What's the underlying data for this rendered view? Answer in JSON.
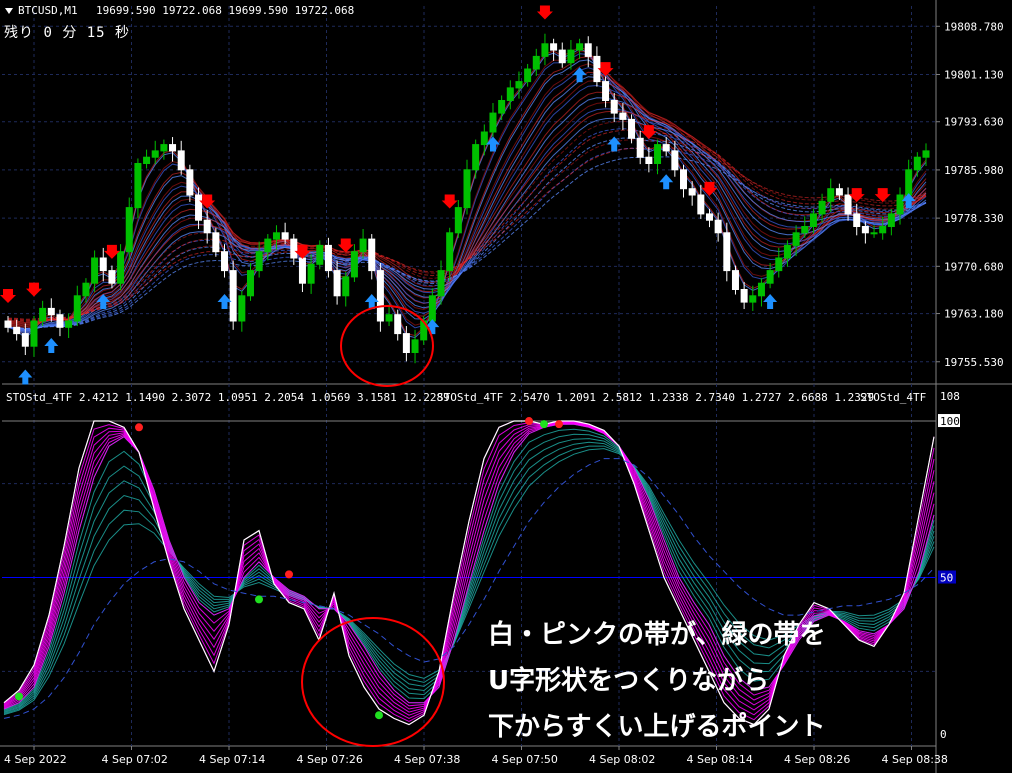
{
  "header": {
    "symbol": "BTCUSD,M1",
    "ohlc": "19699.590 19722.068 19699.590 19722.068",
    "timer_label": "残り",
    "timer_min": "0",
    "timer_min_unit": "分",
    "timer_sec": "15",
    "timer_sec_unit": "秒"
  },
  "indicator_header": {
    "label1": "STOStd_4TF 2.4212 1.1490 2.3072 1.0951 2.2054 1.0569 3.1581 12.2289",
    "label2": "STOStd_4TF 2.5470 1.2091 2.5812 1.2338 2.7340 1.2727 2.6688 1.2329",
    "label3": "STOStd_4TF"
  },
  "annotation": {
    "line1": "白・ピンクの帯が、緑の帯を",
    "line2": "U字形状をつくりながら",
    "line3": "下からすくい上げるポイント"
  },
  "colors": {
    "background": "#000000",
    "grid": "#1e2a5a",
    "bull_candle": "#00c000",
    "bear_candle": "#ffffff",
    "up_arrow": "#1e90ff",
    "down_arrow": "#ff0000",
    "blue_band": "#4169e1",
    "red_band": "#ff2020",
    "stoch_fast": "#ff00ff",
    "stoch_slow": "#20b2aa",
    "level_line": "#0000ff",
    "circle": "#ff0000"
  },
  "chart_data": [
    {
      "type": "candlestick",
      "title": "BTCUSD,M1",
      "y_ticks": [
        "19808.780",
        "19801.130",
        "19793.630",
        "19785.980",
        "19778.330",
        "19770.680",
        "19763.180",
        "19755.530"
      ],
      "ylim": [
        19752.0,
        19812.0
      ],
      "closes": [
        19761,
        19760,
        19758,
        19762,
        19764,
        19763,
        19761,
        19762,
        19766,
        19768,
        19772,
        19770,
        19768,
        19773,
        19780,
        19787,
        19788,
        19789,
        19790,
        19789,
        19786,
        19782,
        19778,
        19776,
        19773,
        19770,
        19762,
        19766,
        19770,
        19773,
        19775,
        19776,
        19775,
        19772,
        19768,
        19771,
        19774,
        19770,
        19766,
        19769,
        19773,
        19775,
        19770,
        19762,
        19763,
        19760,
        19757,
        19759,
        19762,
        19766,
        19770,
        19776,
        19780,
        19786,
        19790,
        19792,
        19795,
        19797,
        19799,
        19800,
        19802,
        19804,
        19806,
        19805,
        19803,
        19805,
        19806,
        19804,
        19800,
        19797,
        19795,
        19794,
        19791,
        19788,
        19787,
        19790,
        19789,
        19786,
        19783,
        19782,
        19779,
        19778,
        19776,
        19770,
        19767,
        19765,
        19766,
        19768,
        19770,
        19772,
        19774,
        19776,
        19777,
        19779,
        19781,
        19783,
        19782,
        19779,
        19777,
        19776,
        19776,
        19777,
        19779,
        19782,
        19786,
        19788,
        19789
      ],
      "sell_signals": [
        0,
        3,
        12,
        23,
        34,
        39,
        51,
        62,
        69,
        74,
        81,
        98,
        101
      ],
      "buy_signals": [
        2,
        5,
        11,
        25,
        42,
        49,
        56,
        66,
        70,
        76,
        88,
        104
      ],
      "x_tick_labels": [
        "4 Sep 2022",
        "4 Sep 07:02",
        "4 Sep 07:14",
        "4 Sep 07:26",
        "4 Sep 07:38",
        "4 Sep 07:50",
        "4 Sep 08:02",
        "4 Sep 08:14",
        "4 Sep 08:26",
        "4 Sep 08:38"
      ]
    },
    {
      "type": "line",
      "title": "STOStd_4TF",
      "ylim": [
        0,
        108
      ],
      "y_ticks": [
        "108",
        "100",
        "50",
        "0"
      ],
      "levels": [
        50,
        100
      ],
      "series": [
        {
          "values": [
            10,
            14,
            22,
            38,
            60,
            85,
            100,
            100,
            98,
            90,
            72,
            55,
            40,
            30,
            20,
            35,
            62,
            65,
            48,
            42,
            40,
            30,
            45,
            25,
            15,
            8,
            5,
            3,
            6,
            20,
            45,
            68,
            88,
            98,
            100,
            100,
            99,
            100,
            100,
            99,
            97,
            92,
            80,
            65,
            50,
            40,
            30,
            20,
            10,
            5,
            3,
            8,
            25,
            35,
            42,
            40,
            35,
            30,
            28,
            35,
            45,
            70,
            95
          ]
        },
        {
          "values": [
            8,
            10,
            15,
            28,
            45,
            65,
            82,
            92,
            95,
            90,
            78,
            62,
            50,
            42,
            38,
            40,
            50,
            55,
            50,
            46,
            44,
            40,
            40,
            35,
            28,
            20,
            14,
            10,
            10,
            15,
            30,
            48,
            65,
            80,
            90,
            96,
            98,
            99,
            99,
            98,
            96,
            92,
            85,
            75,
            62,
            50,
            42,
            35,
            25,
            18,
            14,
            15,
            22,
            30,
            36,
            38,
            36,
            33,
            32,
            35,
            40,
            52,
            70
          ]
        },
        {
          "values": [
            5,
            6,
            8,
            12,
            18,
            26,
            35,
            42,
            48,
            52,
            55,
            56,
            55,
            52,
            48,
            46,
            45,
            44,
            44,
            43,
            42,
            41,
            40,
            38,
            35,
            32,
            28,
            25,
            23,
            24,
            28,
            35,
            43,
            52,
            60,
            68,
            74,
            79,
            83,
            86,
            88,
            88,
            86,
            82,
            76,
            70,
            63,
            57,
            52,
            47,
            43,
            40,
            38,
            38,
            39,
            40,
            41,
            41,
            42,
            43,
            45,
            48,
            53
          ]
        }
      ],
      "signal_dots_red": [
        [
          9,
          98
        ],
        [
          19,
          51
        ],
        [
          35,
          100
        ],
        [
          37,
          99
        ]
      ],
      "signal_dots_green": [
        [
          1,
          12
        ],
        [
          17,
          43
        ],
        [
          25,
          6
        ],
        [
          36,
          99
        ]
      ]
    }
  ]
}
